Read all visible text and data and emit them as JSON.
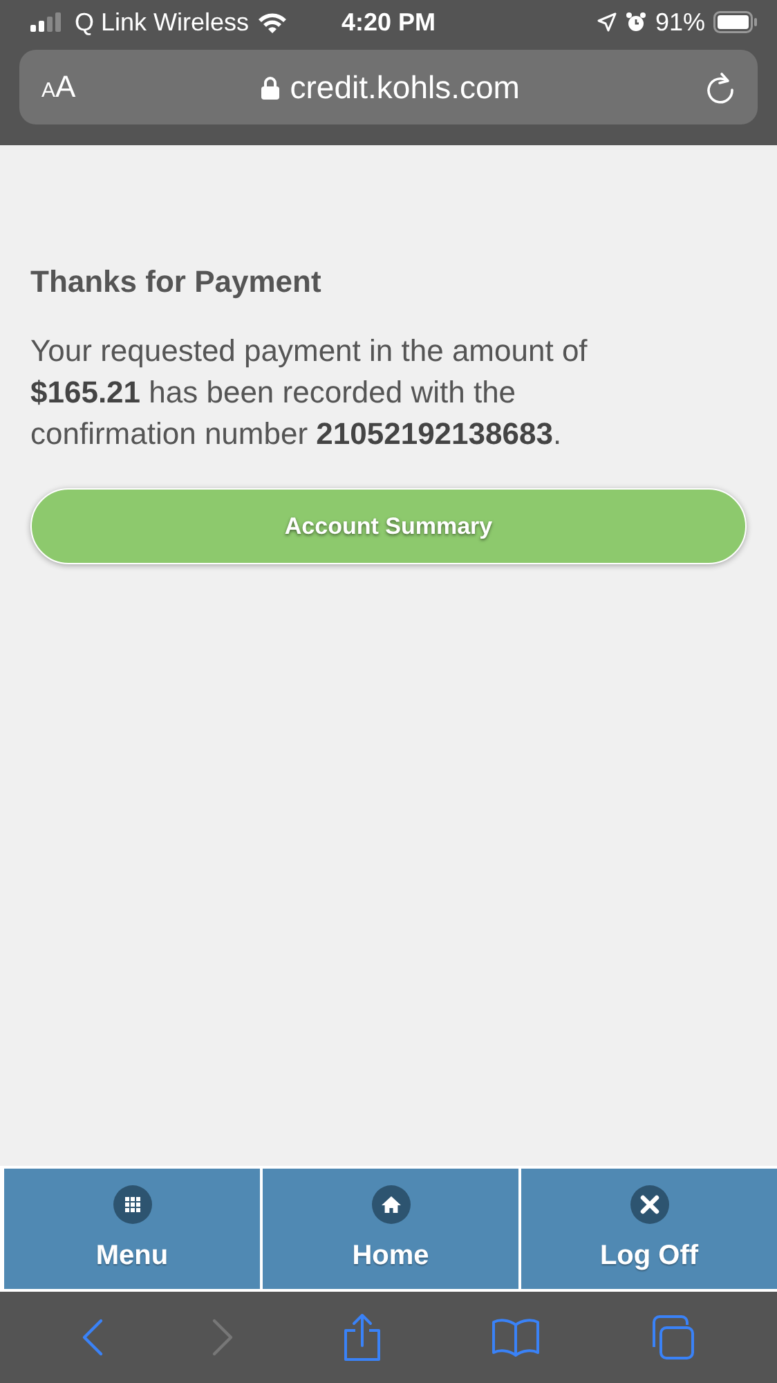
{
  "status_bar": {
    "carrier": "Q Link Wireless",
    "time": "4:20 PM",
    "battery": "91%"
  },
  "address_bar": {
    "text_size": "AA",
    "url": "credit.kohls.com"
  },
  "page": {
    "title": "Thanks for Payment",
    "message": "Your requested payment in the amount of **$165.21** has been recorded with the confirmation number **21052192138683**.",
    "button": "Account Summary"
  },
  "bottom_nav": [
    {
      "kind": "menu",
      "label": "Menu"
    },
    {
      "kind": "home",
      "label": "Home"
    },
    {
      "kind": "logoff",
      "label": "Log Off"
    }
  ],
  "browser_toolbar": {
    "back_disabled": false,
    "forward_disabled": true
  }
}
